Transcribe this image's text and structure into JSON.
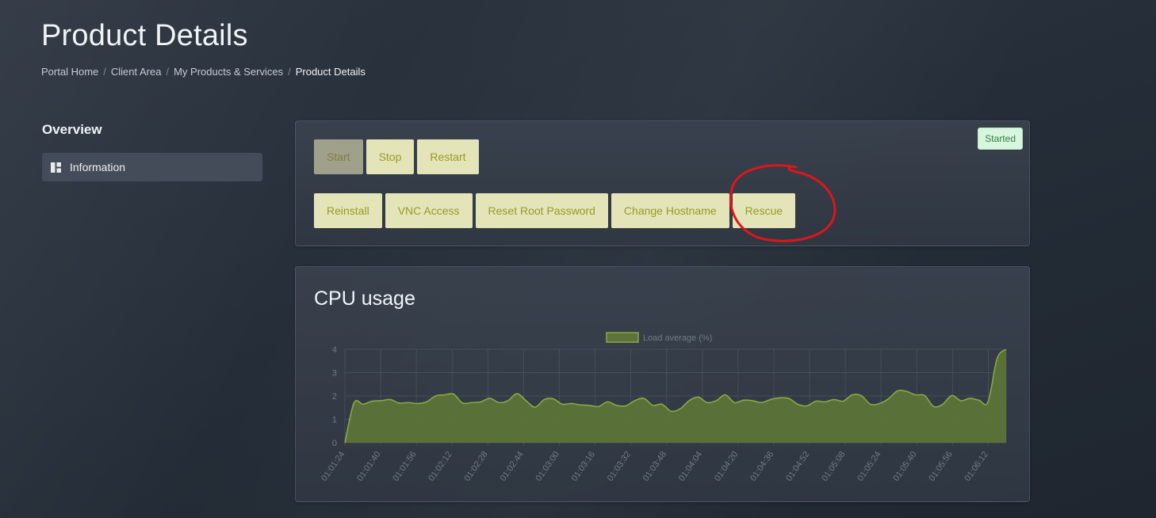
{
  "page": {
    "title": "Product Details"
  },
  "breadcrumb": [
    {
      "label": "Portal Home"
    },
    {
      "label": "Client Area"
    },
    {
      "label": "My Products & Services"
    },
    {
      "label": "Product Details"
    }
  ],
  "sidebar": {
    "heading": "Overview",
    "items": [
      {
        "label": "Information",
        "icon": "dashboard-icon"
      }
    ]
  },
  "actions": {
    "status": "Started",
    "status_color": "#d8f6dd",
    "buttons_row1": [
      {
        "label": "Start",
        "disabled": true
      },
      {
        "label": "Stop"
      },
      {
        "label": "Restart"
      }
    ],
    "buttons_row2": [
      {
        "label": "Reinstall"
      },
      {
        "label": "VNC Access"
      },
      {
        "label": "Reset Root Password"
      },
      {
        "label": "Change Hostname"
      },
      {
        "label": "Rescue"
      }
    ],
    "button_color": "#e3e4b8",
    "annotation_color": "#e0151b"
  },
  "chart": {
    "title": "CPU usage"
  },
  "chart_data": {
    "type": "area",
    "title": "CPU usage",
    "xlabel": "",
    "ylabel": "",
    "ylim": [
      0,
      4
    ],
    "yticks": [
      "0",
      "1",
      "2",
      "3",
      "4"
    ],
    "grid": true,
    "legend": "top-center",
    "xticks": [
      "01:01:24",
      "01:01:40",
      "01:01:56",
      "01:02:12",
      "01:02:28",
      "01:02:44",
      "01:03:00",
      "01:03:16",
      "01:03:32",
      "01:03:48",
      "01:04:04",
      "01:04:20",
      "01:04:36",
      "01:04:52",
      "01:05:08",
      "01:05:24",
      "01:05:40",
      "01:05:56",
      "01:06:12"
    ],
    "series": [
      {
        "name": "Load average (%)",
        "color": "#8aa844",
        "fill": "#5d7339",
        "values": [
          0.0,
          1.7,
          1.65,
          1.78,
          1.8,
          1.85,
          1.7,
          1.72,
          1.68,
          1.75,
          2.0,
          2.05,
          2.08,
          1.7,
          1.72,
          1.75,
          1.9,
          1.72,
          1.8,
          2.1,
          1.8,
          1.52,
          1.85,
          1.88,
          1.65,
          1.68,
          1.62,
          1.6,
          1.55,
          1.75,
          1.6,
          1.58,
          1.8,
          1.9,
          1.6,
          1.65,
          1.35,
          1.45,
          1.8,
          1.95,
          1.72,
          1.8,
          2.05,
          1.72,
          1.82,
          1.8,
          1.72,
          1.85,
          1.92,
          1.9,
          1.65,
          1.58,
          1.78,
          1.75,
          1.85,
          1.78,
          2.05,
          2.02,
          1.65,
          1.68,
          1.88,
          2.22,
          2.2,
          2.05,
          2.02,
          1.55,
          1.65,
          2.02,
          1.8,
          1.9,
          1.82,
          1.75,
          3.6,
          4.0
        ]
      }
    ]
  }
}
